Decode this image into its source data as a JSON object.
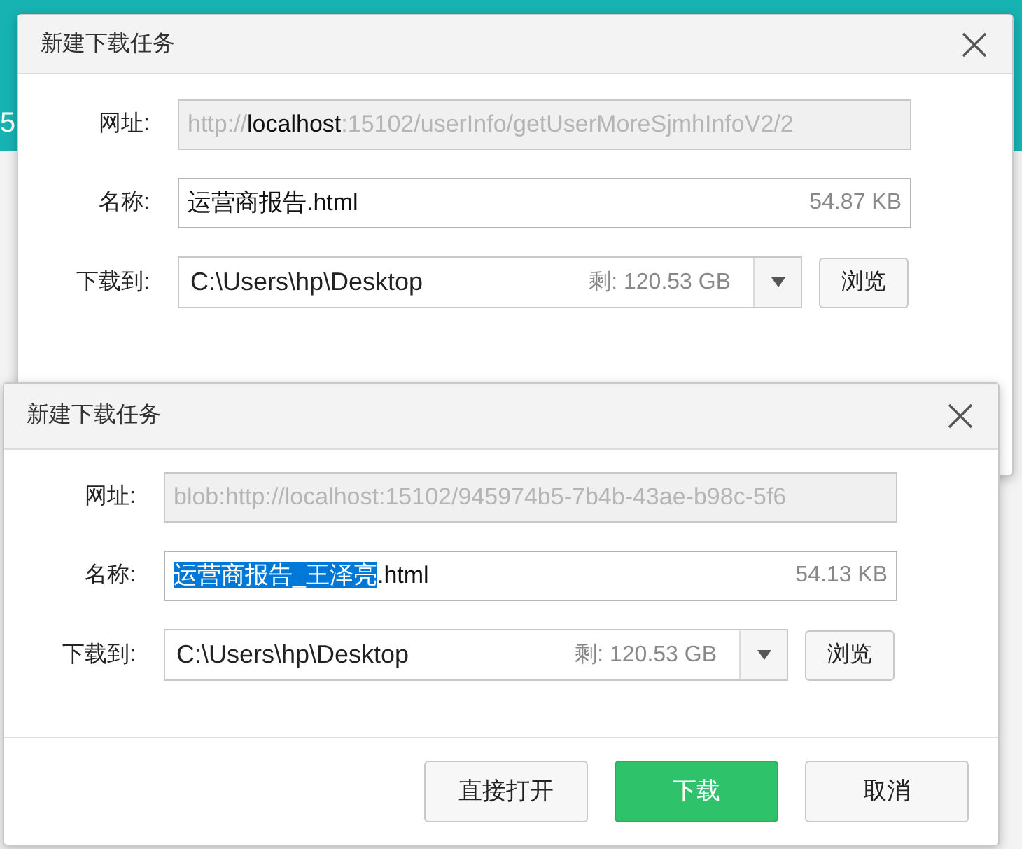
{
  "background": {
    "edge_text": "5"
  },
  "dialogs": [
    {
      "title": "新建下载任务",
      "url_label": "网址:",
      "url_parts": [
        {
          "text": "http://",
          "strong": false
        },
        {
          "text": "localhost",
          "strong": true
        },
        {
          "text": ":15102/userInfo/getUserMoreSjmhInfoV2/2",
          "strong": false
        }
      ],
      "name_label": "名称:",
      "name_parts": [
        {
          "text": "运营商报告.html",
          "selected": false
        }
      ],
      "size": "54.87 KB",
      "save_label": "下载到:",
      "save_path": "C:\\Users\\hp\\Desktop",
      "free_space": "剩: 120.53 GB",
      "browse": "浏览"
    },
    {
      "title": "新建下载任务",
      "url_label": "网址:",
      "url_parts": [
        {
          "text": "blob:http://localhost:15102/945974b5-7b4b-43ae-b98c-5f6",
          "strong": false
        }
      ],
      "name_label": "名称:",
      "name_parts": [
        {
          "text": "运营商报告_王泽亮",
          "selected": true
        },
        {
          "text": ".html",
          "selected": false
        }
      ],
      "size": "54.13 KB",
      "save_label": "下载到:",
      "save_path": "C:\\Users\\hp\\Desktop",
      "free_space": "剩: 120.53 GB",
      "browse": "浏览",
      "buttons": [
        {
          "label": "直接打开",
          "kind": "plain"
        },
        {
          "label": "下载",
          "kind": "primary"
        },
        {
          "label": "取消",
          "kind": "plain"
        }
      ]
    }
  ]
}
